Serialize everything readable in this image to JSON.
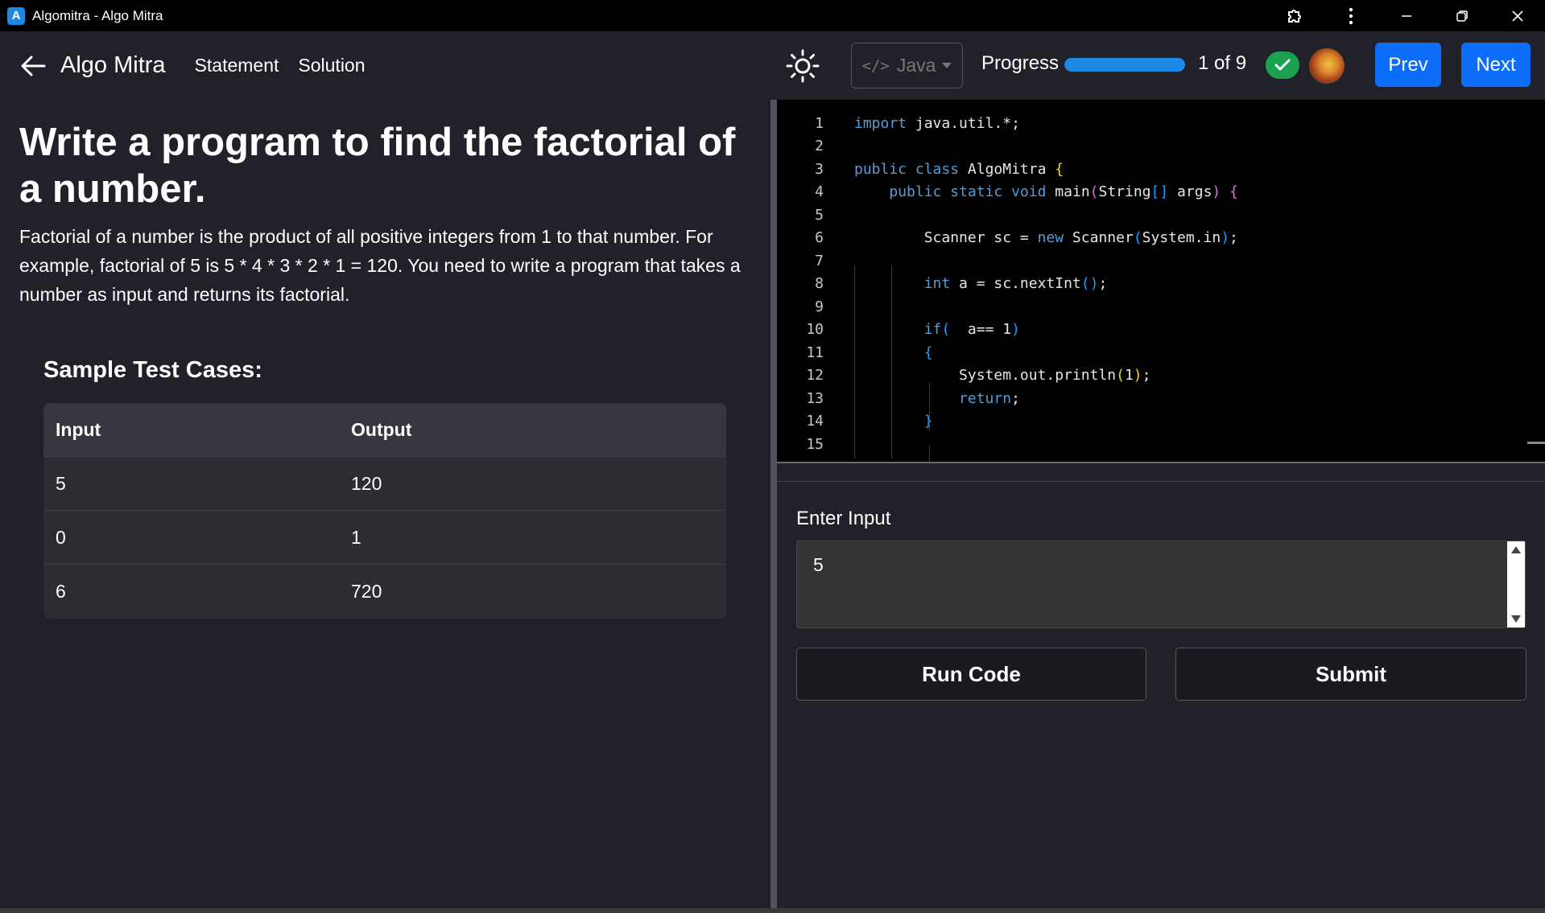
{
  "window": {
    "title": "Algomitra - Algo Mitra"
  },
  "header": {
    "brand": "Algo Mitra",
    "nav": {
      "statement": "Statement",
      "solution": "Solution"
    },
    "language": "Java",
    "progress_label": "Progress",
    "progress_fraction": 1.0,
    "progress_count": "1 of 9",
    "prev_label": "Prev",
    "next_label": "Next",
    "accent_color": "#0d6efd",
    "success_color": "#1aa251"
  },
  "problem": {
    "title": "Write a program to find the factorial of a number.",
    "description": "Factorial of a number is the product of all positive integers from 1 to that number. For example, factorial of 5 is 5 * 4 * 3 * 2 * 1 = 120. You need to write a program that takes a number as input and returns its factorial.",
    "samples_heading": "Sample Test Cases:",
    "table": {
      "headers": [
        "Input",
        "Output"
      ],
      "rows": [
        [
          "5",
          "120"
        ],
        [
          "0",
          "1"
        ],
        [
          "6",
          "720"
        ]
      ]
    }
  },
  "editor": {
    "line_numbers": [
      "1",
      "2",
      "3",
      "4",
      "5",
      "6",
      "7",
      "8",
      "9",
      "10",
      "11",
      "12",
      "13",
      "14",
      "15"
    ]
  },
  "io": {
    "input_label": "Enter Input",
    "input_value": "5",
    "run_label": "Run Code",
    "submit_label": "Submit"
  }
}
